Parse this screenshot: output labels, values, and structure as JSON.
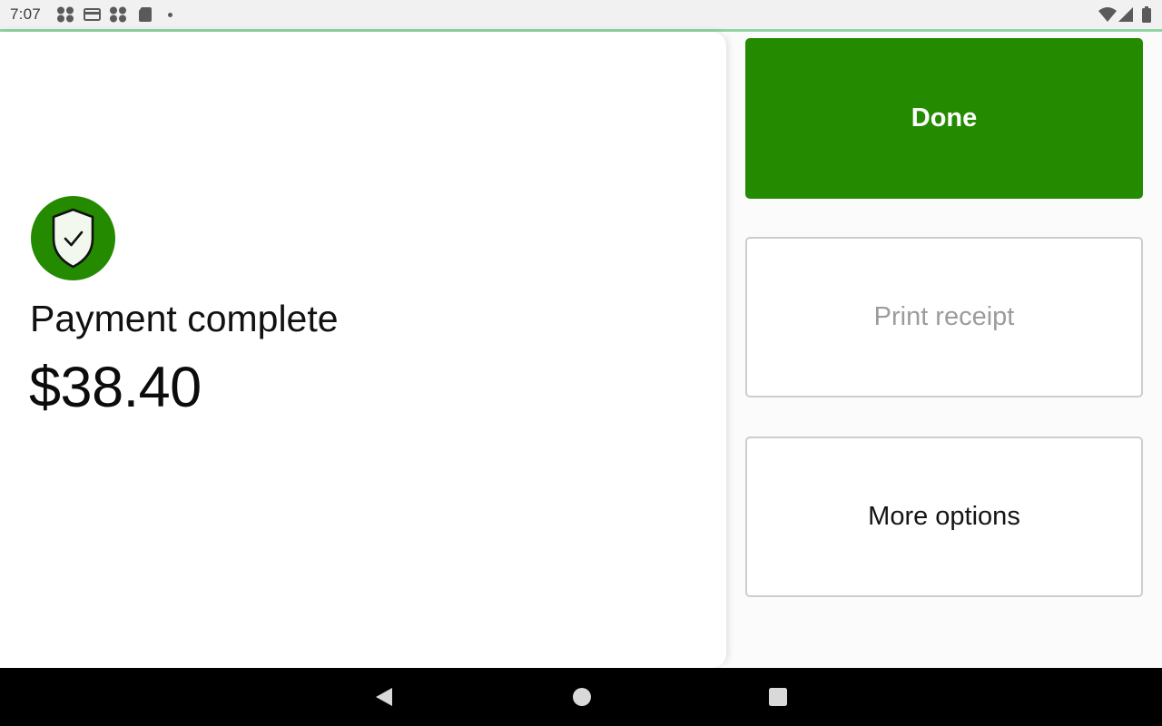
{
  "status_bar": {
    "time": "7:07",
    "left_icons": [
      "app-cluster-icon",
      "card-icon",
      "app-cluster-icon",
      "sd-card-icon",
      "dot-icon"
    ],
    "right_icons": [
      "wifi-icon",
      "cell-signal-icon",
      "battery-icon"
    ]
  },
  "payment": {
    "badge_icon": "shield-check-icon",
    "title": "Payment complete",
    "amount": "$38.40"
  },
  "actions": {
    "done_label": "Done",
    "print_receipt_label": "Print receipt",
    "more_options_label": "More options"
  },
  "nav_bar": {
    "buttons": [
      "back-icon",
      "home-icon",
      "recents-icon"
    ]
  },
  "colors": {
    "brand_green": "#248a00",
    "status_accent": "#8fd6a4",
    "disabled_text": "#9c9c9c"
  }
}
